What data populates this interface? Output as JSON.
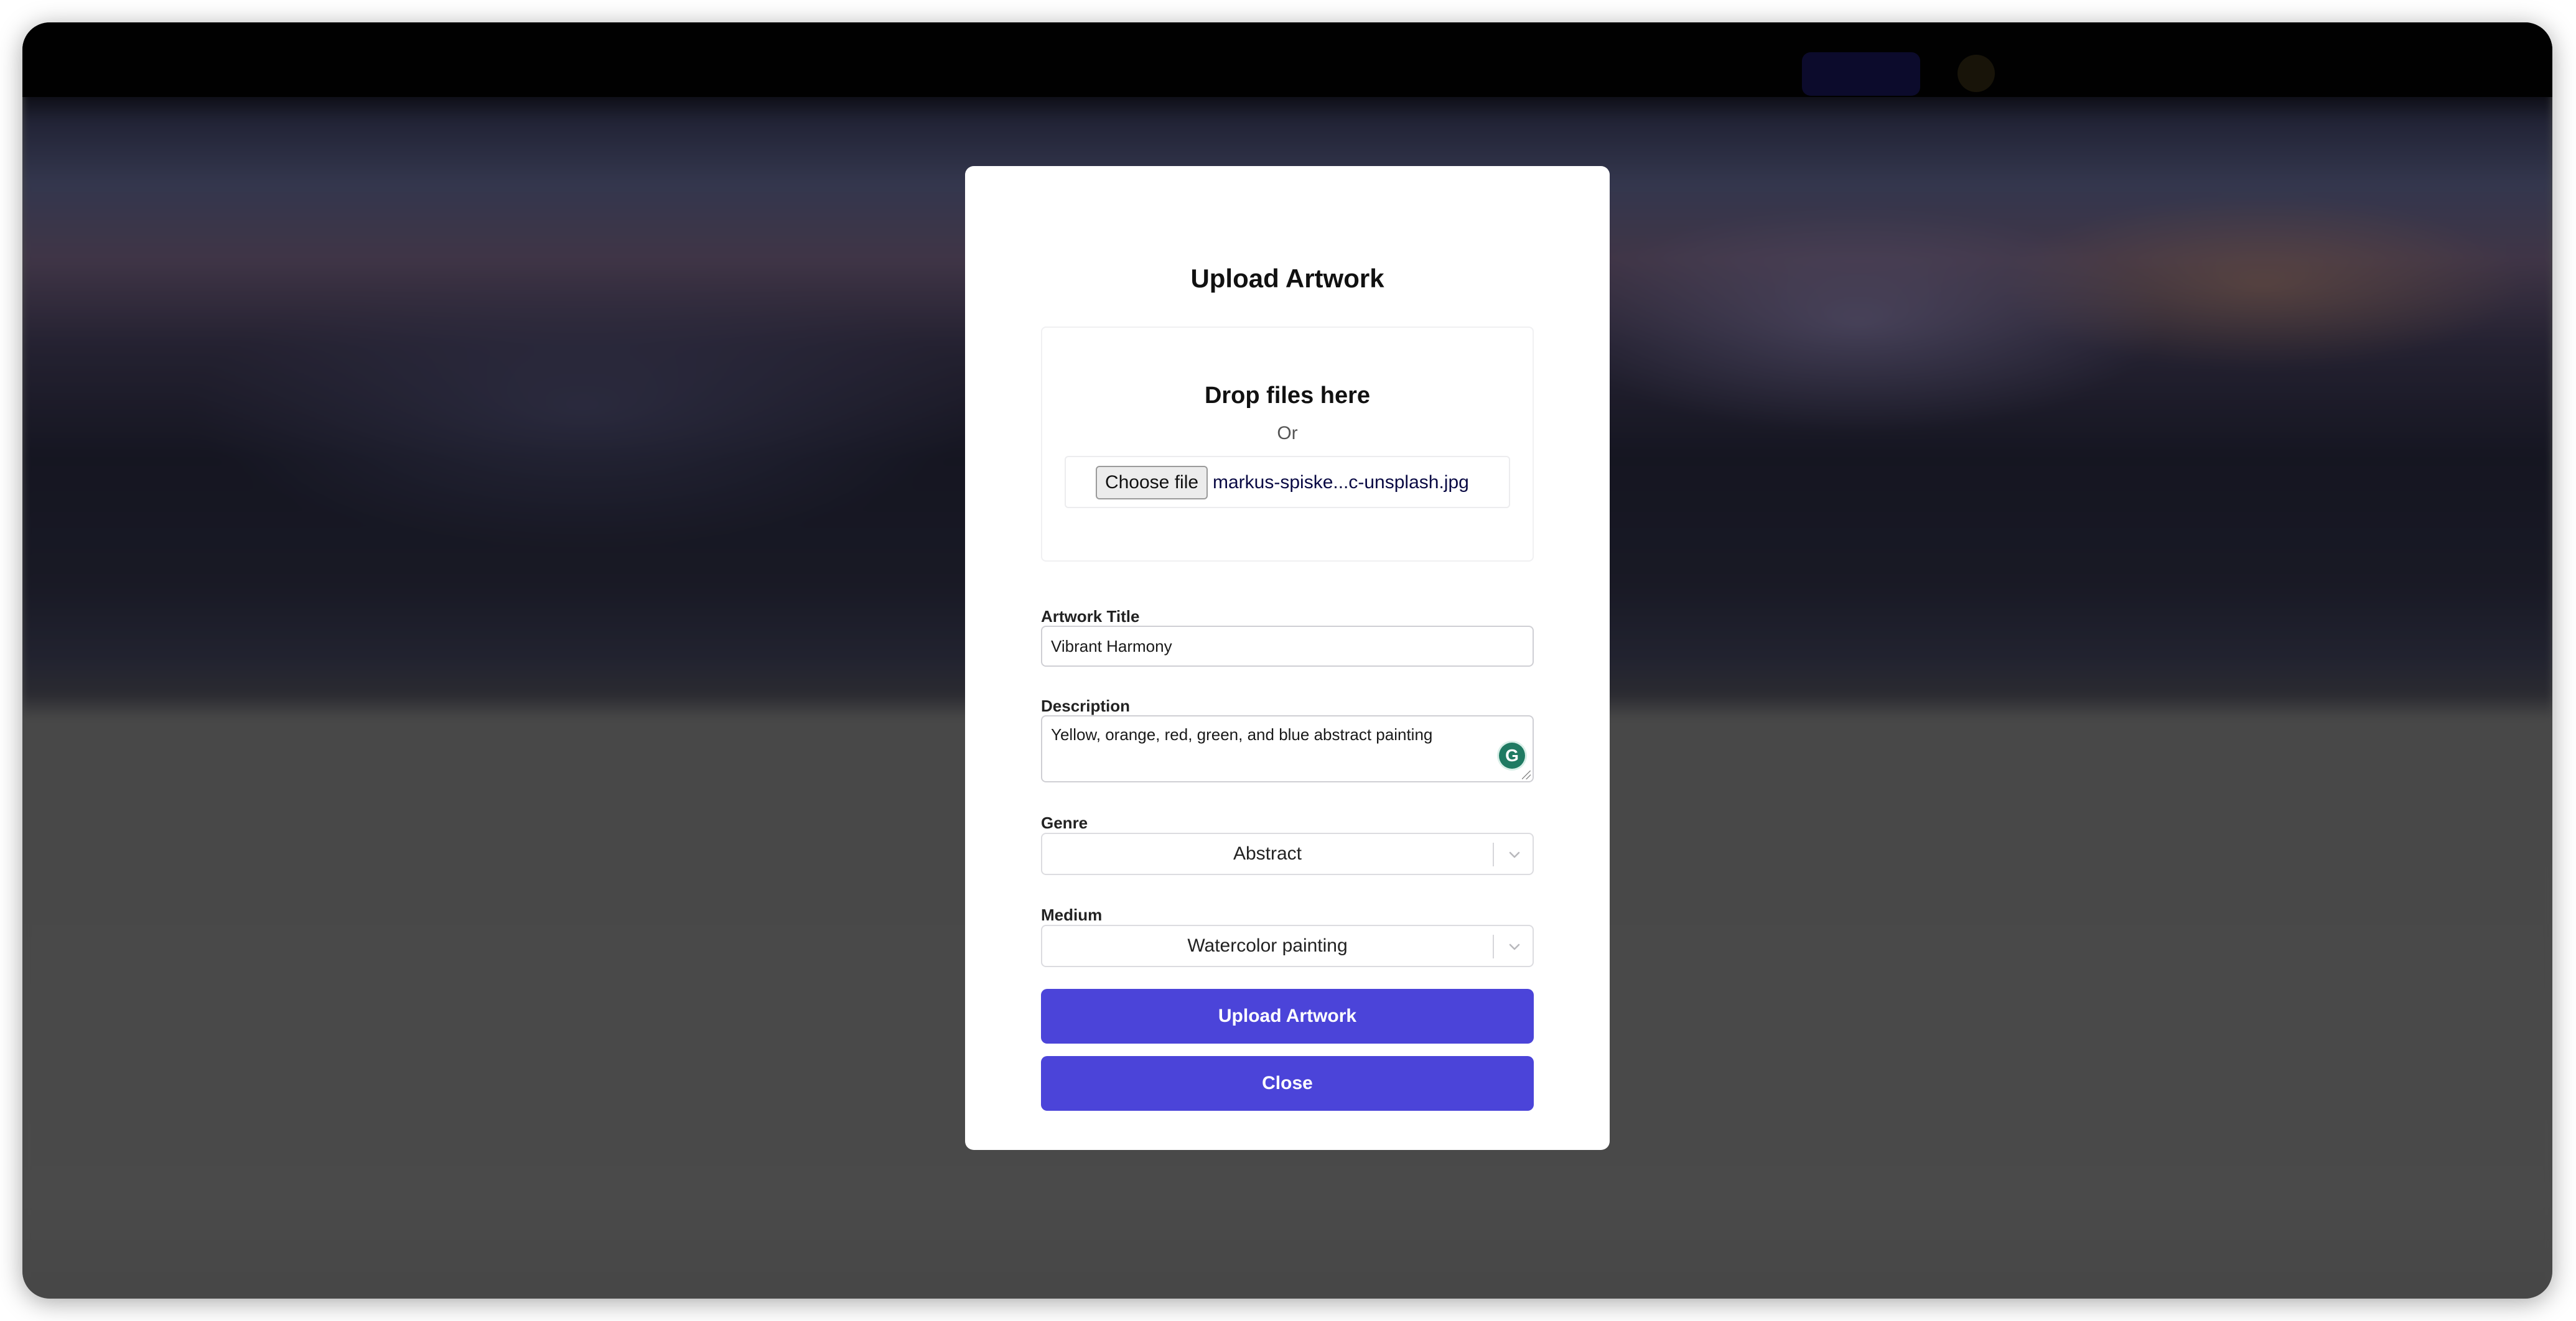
{
  "modal": {
    "title": "Upload Artwork",
    "dropzone": {
      "heading": "Drop files here",
      "or_text": "Or",
      "choose_file_label": "Choose file",
      "file_name": "markus-spiske...c-unsplash.jpg"
    },
    "fields": {
      "title_label": "Artwork Title",
      "title_value": "Vibrant Harmony",
      "description_label": "Description",
      "description_value": "Yellow, orange, red, green, and blue abstract painting",
      "genre_label": "Genre",
      "genre_value": "Abstract",
      "medium_label": "Medium",
      "medium_value": "Watercolor painting"
    },
    "buttons": {
      "upload_label": "Upload Artwork",
      "close_label": "Close"
    }
  },
  "icons": {
    "grammarly": "grammarly-icon",
    "select_chevron": "chevron-down-icon"
  },
  "colors": {
    "primary": "#4b44d9",
    "overlay": "rgba(0,0,0,0.42)",
    "grammarly": "#1f7a62"
  }
}
